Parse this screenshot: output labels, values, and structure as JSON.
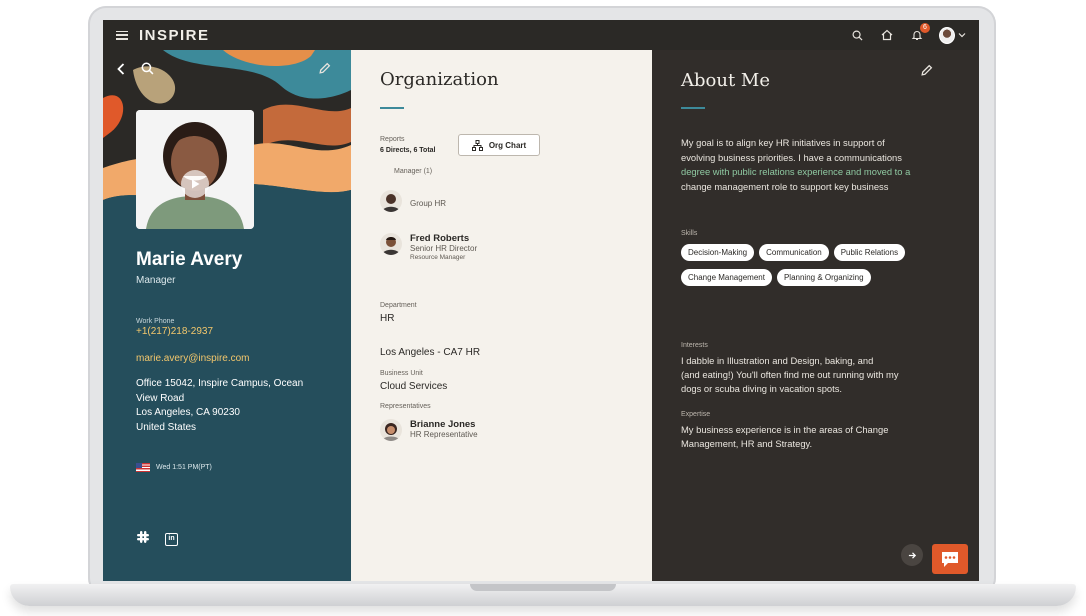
{
  "app": {
    "brand": "INSPIRE",
    "notification_count": "6"
  },
  "profile": {
    "name": "Marie Avery",
    "role": "Manager",
    "work_phone_label": "Work Phone",
    "work_phone": "+1(217)218-2937",
    "email": "marie.avery@inspire.com",
    "address_lines": [
      "Office 15042, Inspire Campus, Ocean",
      "View Road",
      "Los Angeles, CA 90230",
      "United States"
    ],
    "local_time": "Wed 1:51 PM(PT)"
  },
  "organization": {
    "title": "Organization",
    "reports_label": "Reports",
    "reports_value": "6 Directs, 6 Total",
    "org_chart_button": "Org Chart",
    "manager_label": "Manager (1)",
    "manager_partial_title": "Group HR",
    "fred": {
      "name": "Fred Roberts",
      "title": "Senior HR Director",
      "subtitle": "Resource Manager"
    },
    "department_label": "Department",
    "department_value": "HR",
    "location_value": "Los Angeles - CA7 HR",
    "business_unit_label": "Business Unit",
    "business_unit_value": "Cloud Services",
    "representatives_label": "Representatives",
    "brianne": {
      "name": "Brianne Jones",
      "title": "HR Representative"
    }
  },
  "about": {
    "title": "About Me",
    "text_lines": [
      "My goal is to align key HR initiatives in support of",
      "evolving business priorities. I have a communications",
      "degree with public relations experience and moved to a",
      "change management role to support key business"
    ],
    "skills_label": "Skills",
    "skills": [
      "Decision-Making",
      "Communication",
      "Public Relations",
      "Change Management",
      "Planning & Organizing"
    ],
    "interests_label": "Interests",
    "interests_lines": [
      "I dabble in Illustration and Design, baking, and",
      "(and eating!) You'll often find me out running with my",
      "dogs or scuba diving in vacation spots."
    ],
    "expertise_label": "Expertise",
    "expertise_lines": [
      "My business experience is in the areas of Change",
      "Management, HR and Strategy."
    ]
  },
  "colors": {
    "topbar": "#2b2926",
    "left_panel": "#254e5c",
    "accent_gold": "#f3c76c",
    "accent_orange": "#e0592a",
    "accent_teal": "#3d8a9a",
    "right_panel": "#312d2a"
  },
  "icons": {
    "menu": "hamburger-icon",
    "search": "search-icon",
    "home": "home-icon",
    "notifications": "bell-icon",
    "back": "chevron-left-icon",
    "edit": "pencil-icon",
    "play": "play-icon",
    "org_chart": "org-chart-icon",
    "slack": "slack-icon",
    "linkedin": "linkedin-icon",
    "next": "arrow-right-icon",
    "chat": "chat-icon"
  }
}
